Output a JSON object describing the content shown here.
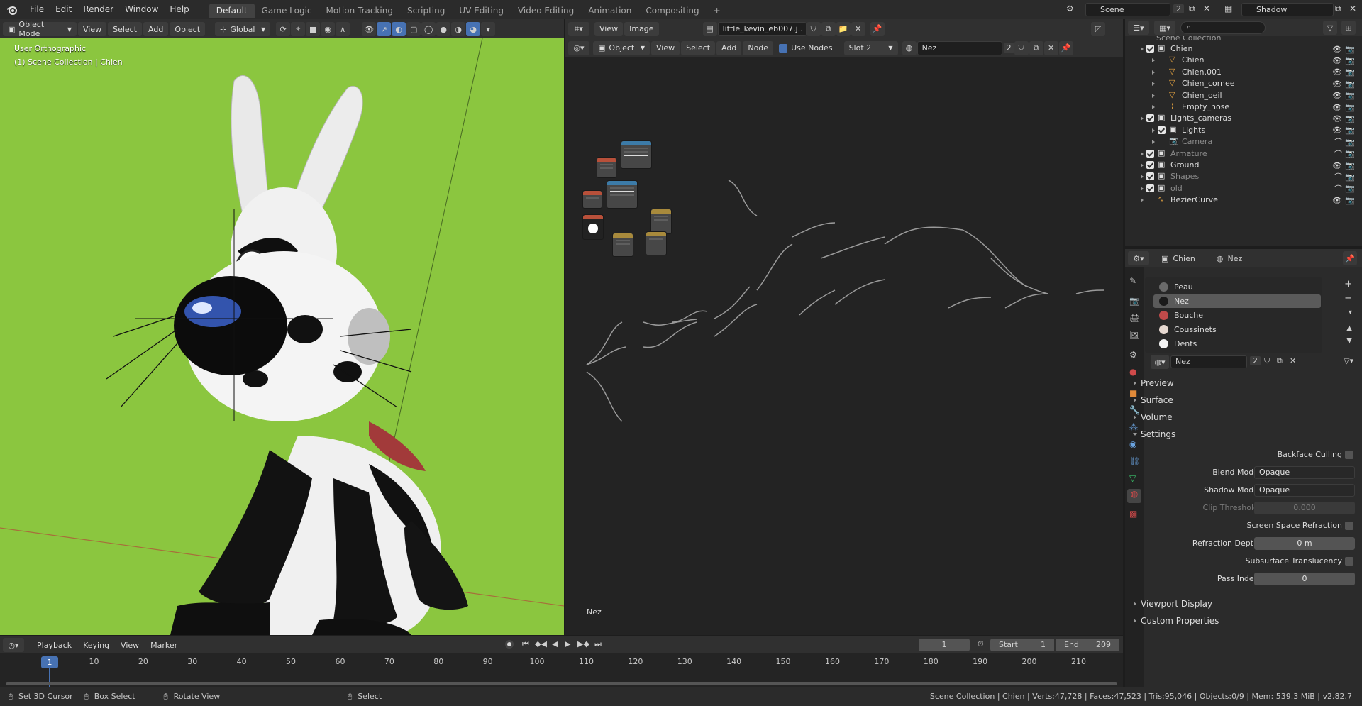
{
  "topbar": {
    "logo": "blender-logo-icon",
    "menus": [
      "File",
      "Edit",
      "Render",
      "Window",
      "Help"
    ],
    "workspaces": [
      "Default",
      "Game Logic",
      "Motion Tracking",
      "Scripting",
      "UV Editing",
      "Video Editing",
      "Animation",
      "Compositing"
    ],
    "active_workspace": "Default",
    "add_tab": "+",
    "scene": "Scene",
    "scene_users": "2",
    "view_layer": "Shadow"
  },
  "viewport": {
    "mode": "Object Mode",
    "menus": [
      "View",
      "Select",
      "Add",
      "Object"
    ],
    "orientation": "Global",
    "info_line1": "User Orthographic",
    "info_line2": "(1) Scene Collection | Chien",
    "background_color": "#8bc63f"
  },
  "node_editor": {
    "editor_icon": "node-editor-icon",
    "object_mode": "Object",
    "menus": [
      "View",
      "Select",
      "Add",
      "Node"
    ],
    "use_nodes_label": "Use Nodes",
    "slot": "Slot 2",
    "material": "Nez",
    "material_users": "2",
    "image_menus": [
      "View",
      "Image"
    ],
    "image_name": "little_kevin_eb007.j..",
    "footer_label": "Nez"
  },
  "outliner": {
    "header_label": "Scene Collection",
    "rows": [
      {
        "label": "Chien",
        "indent": 1,
        "type": "collection"
      },
      {
        "label": "Chien",
        "indent": 2,
        "type": "mesh"
      },
      {
        "label": "Chien.001",
        "indent": 2,
        "type": "mesh"
      },
      {
        "label": "Chien_cornee",
        "indent": 2,
        "type": "mesh"
      },
      {
        "label": "Chien_oeil",
        "indent": 2,
        "type": "mesh"
      },
      {
        "label": "Empty_nose",
        "indent": 2,
        "type": "empty"
      },
      {
        "label": "Lights_cameras",
        "indent": 1,
        "type": "collection"
      },
      {
        "label": "Lights",
        "indent": 2,
        "type": "collection"
      },
      {
        "label": "Camera",
        "indent": 2,
        "type": "camera"
      },
      {
        "label": "Armature",
        "indent": 1,
        "type": "collection"
      },
      {
        "label": "Ground",
        "indent": 1,
        "type": "collection"
      },
      {
        "label": "Shapes",
        "indent": 1,
        "type": "collection"
      },
      {
        "label": "old",
        "indent": 1,
        "type": "collection"
      },
      {
        "label": "BezierCurve",
        "indent": 1,
        "type": "curve"
      }
    ]
  },
  "properties": {
    "object": "Chien",
    "material": "Nez",
    "materials": [
      {
        "name": "Peau",
        "color": "#6a6a6a"
      },
      {
        "name": "Nez",
        "color": "#1a1a1a"
      },
      {
        "name": "Bouche",
        "color": "#c04a4a"
      },
      {
        "name": "Coussinets",
        "color": "#e6d8d0"
      },
      {
        "name": "Dents",
        "color": "#f2f2f2"
      }
    ],
    "material_field": "Nez",
    "material_users": "2",
    "panels": {
      "preview": "Preview",
      "surface": "Surface",
      "volume": "Volume",
      "settings": "Settings",
      "viewport_display": "Viewport Display",
      "custom_properties": "Custom Properties"
    },
    "settings": {
      "backface_culling": "Backface Culling",
      "blend_mode_label": "Blend Mode",
      "blend_mode": "Opaque",
      "shadow_mode_label": "Shadow Mode",
      "shadow_mode": "Opaque",
      "clip_threshold_label": "Clip Threshold",
      "clip_threshold": "0.000",
      "ssr_label": "Screen Space Refraction",
      "refraction_depth_label": "Refraction Depth",
      "refraction_depth": "0 m",
      "sss_label": "Subsurface Translucency",
      "pass_index_label": "Pass Index",
      "pass_index": "0"
    }
  },
  "timeline": {
    "menus": [
      "Playback",
      "Keying",
      "View",
      "Marker"
    ],
    "current_frame": "1",
    "start_label": "Start",
    "start": "1",
    "end_label": "End",
    "end": "209",
    "ticks": [
      "1",
      "10",
      "20",
      "30",
      "40",
      "50",
      "60",
      "70",
      "80",
      "90",
      "100",
      "110",
      "120",
      "130",
      "140",
      "150",
      "160",
      "170",
      "180",
      "190",
      "200",
      "210"
    ]
  },
  "status": {
    "left_hint_1": "Set 3D Cursor",
    "left_hint_2": "Box Select",
    "left_hint_3": "Rotate View",
    "left_hint_4": "Select",
    "info": "Scene Collection | Chien | Verts:47,728 | Faces:47,523 | Tris:95,046 | Objects:0/9 | Mem: 539.3 MiB | v2.82.7"
  }
}
